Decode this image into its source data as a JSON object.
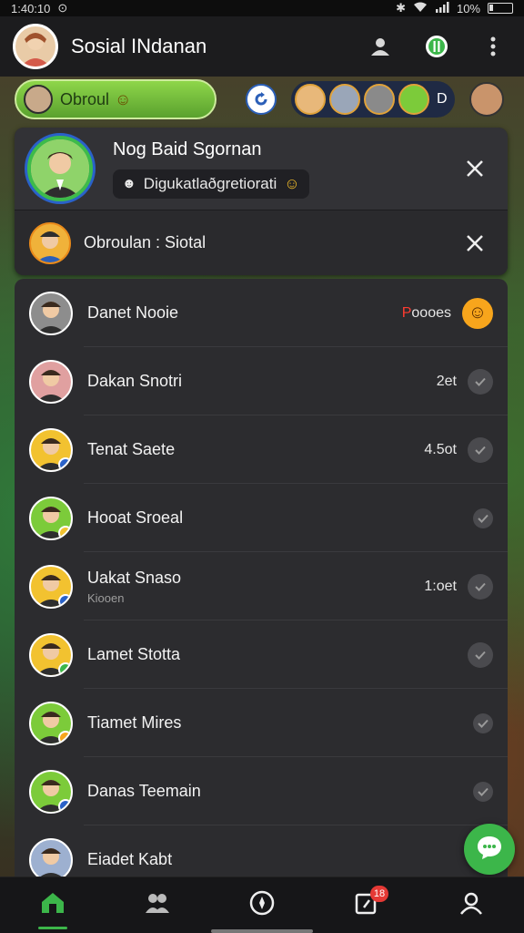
{
  "status_bar": {
    "time": "1:40:10",
    "battery": "10%"
  },
  "header": {
    "title": "Sosial INdanan"
  },
  "stories": {
    "pill_label": "Obroul",
    "more_label": "D"
  },
  "panel": {
    "title": "Nog Baid Sgornan",
    "chip_text": "Digukatlaðgretiorati",
    "row2_label": "Obroulan : Siotal"
  },
  "chats": [
    {
      "name": "Danet Nooie",
      "meta": "Poooes",
      "meta_red": "P",
      "sub": "",
      "status": "emoji",
      "avatar_bg": "#8d8d8d",
      "badge": ""
    },
    {
      "name": "Dakan Snotri",
      "meta": "2et",
      "meta_red": "",
      "sub": "",
      "status": "check",
      "avatar_bg": "#e0a0a0",
      "badge": ""
    },
    {
      "name": "Tenat Saete",
      "meta": "4.5ot",
      "meta_red": "",
      "sub": "",
      "status": "check",
      "avatar_bg": "#f2c230",
      "badge": "#2a62c9"
    },
    {
      "name": "Hooat Sroeal",
      "meta": "",
      "meta_red": "",
      "sub": "",
      "status": "check-small",
      "avatar_bg": "#7ccb3a",
      "badge": "#f2c230"
    },
    {
      "name": "Uakat Snaso",
      "meta": "1:oet",
      "meta_red": "",
      "sub": "Kiooen",
      "status": "check",
      "avatar_bg": "#f2c230",
      "badge": "#2a62c9"
    },
    {
      "name": "Lamet Stotta",
      "meta": "",
      "meta_red": "",
      "sub": "",
      "status": "check",
      "avatar_bg": "#f2c230",
      "badge": "#3cb64a"
    },
    {
      "name": "Tiamet Mires",
      "meta": "",
      "meta_red": "",
      "sub": "",
      "status": "check-small",
      "avatar_bg": "#7ccb3a",
      "badge": "#f7a51c"
    },
    {
      "name": "Danas Teemain",
      "meta": "",
      "meta_red": "",
      "sub": "",
      "status": "check-small",
      "avatar_bg": "#7ccb3a",
      "badge": "#2a62c9"
    },
    {
      "name": "Eiadet Kabt",
      "meta": "",
      "meta_red": "",
      "sub": "",
      "status": "none",
      "avatar_bg": "#9db0d0",
      "badge": ""
    }
  ],
  "nav": {
    "badge_count": "18"
  },
  "colors": {
    "accent": "#3cb64a",
    "header_bg": "#1c1c1e",
    "panel_bg": "#2c2c2f",
    "alert": "#e53935"
  },
  "icons": [
    "wifi-icon",
    "battery-icon",
    "people-icon",
    "status-icon",
    "more-vert-icon",
    "refresh-icon",
    "close-icon",
    "check-icon",
    "chat-bubble-icon",
    "home-icon",
    "community-icon",
    "compass-icon",
    "calls-icon",
    "profile-icon"
  ]
}
